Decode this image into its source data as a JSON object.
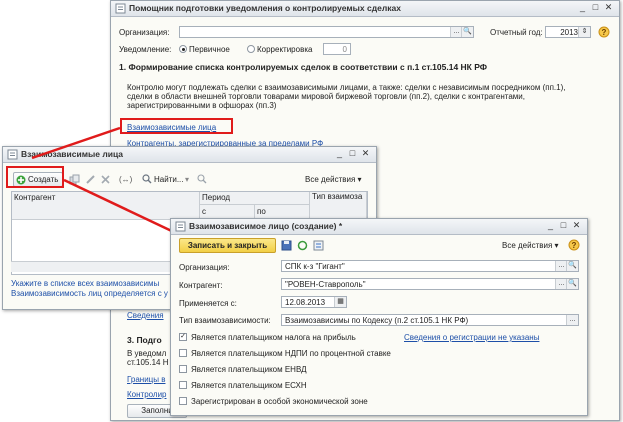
{
  "main_window": {
    "title": "Помощник подготовки уведомления о контролируемых сделках",
    "org_label": "Организация:",
    "period_label": "Отчетный год:",
    "period_value": "2013",
    "notice_label": "Уведомление:",
    "radio_primary": "Первичное",
    "radio_correction": "Корректировка",
    "correction_number": "0",
    "section1_title": "1. Формирование списка контролируемых сделок в соответствии с п.1 ст.105.14 НК РФ",
    "section1_text_1": "Контролю могут подлежать сделки с взаимозависимыми лицами, а также: сделки с независимым посредником (пп.1),",
    "section1_text_2": "сделки в области внешней торговли товарами мировой биржевой торговли (пп.2), сделки с контрагентами,",
    "section1_text_3": "зарегистрированными в офшорах (пп.3)",
    "link_related": "Взаимозависимые лица",
    "link_offshore": "Контрагенты, зарегистрированные за пределами РФ",
    "link_partial_1": "Сведения",
    "section3_partial": "3. Подго",
    "section3_text_1": "В уведомл",
    "section3_text_2": "ст.105.14 Н",
    "link_partial_2": "Границы в",
    "link_partial_3": "Контролир",
    "button_partial": "Заполни"
  },
  "list_window": {
    "title": "Взаимозависимые лица",
    "create_button": "Создать",
    "find_button": "Найти...",
    "all_actions": "Все действия",
    "col_counterparty": "Контрагент",
    "col_period": "Период",
    "col_from": "с",
    "col_to": "по",
    "col_type": "Тип взаимоза",
    "footer_1": "Укажите в списке всех взаимозависимы",
    "footer_2": "Взаимозависимость лиц определяется с у"
  },
  "create_window": {
    "title": "Взаимозависимое лицо (создание) *",
    "save_close": "Записать и закрыть",
    "all_actions": "Все действия",
    "org_label": "Организация:",
    "org_value": "СПК к-з \"Гигант\"",
    "counterparty_label": "Контрагент:",
    "counterparty_value": "\"РОВЕН-Ставрополь\"",
    "applies_label": "Применяется с:",
    "applies_value": "12.08.2013",
    "type_label": "Тип взаимозависимости:",
    "type_value": "Взаимозависимы по Кодексу (п.2 ст.105.1 НК РФ)",
    "checkboxes": [
      {
        "label": "Является плательщиком налога на прибыль",
        "checked": true
      },
      {
        "label": "Является плательщиком НДПИ по процентной ставке",
        "checked": false
      },
      {
        "label": "Является плательщиком ЕНВД",
        "checked": false
      },
      {
        "label": "Является плательщиком ЕСХН",
        "checked": false
      },
      {
        "label": "Зарегистрирован в особой экономической зоне",
        "checked": false
      }
    ],
    "registration_link": "Сведения о регистрации не указаны"
  },
  "colors": {
    "accent_red": "#e01b1b",
    "link_blue": "#1d4fa8",
    "save_button": "#f5d85c"
  }
}
